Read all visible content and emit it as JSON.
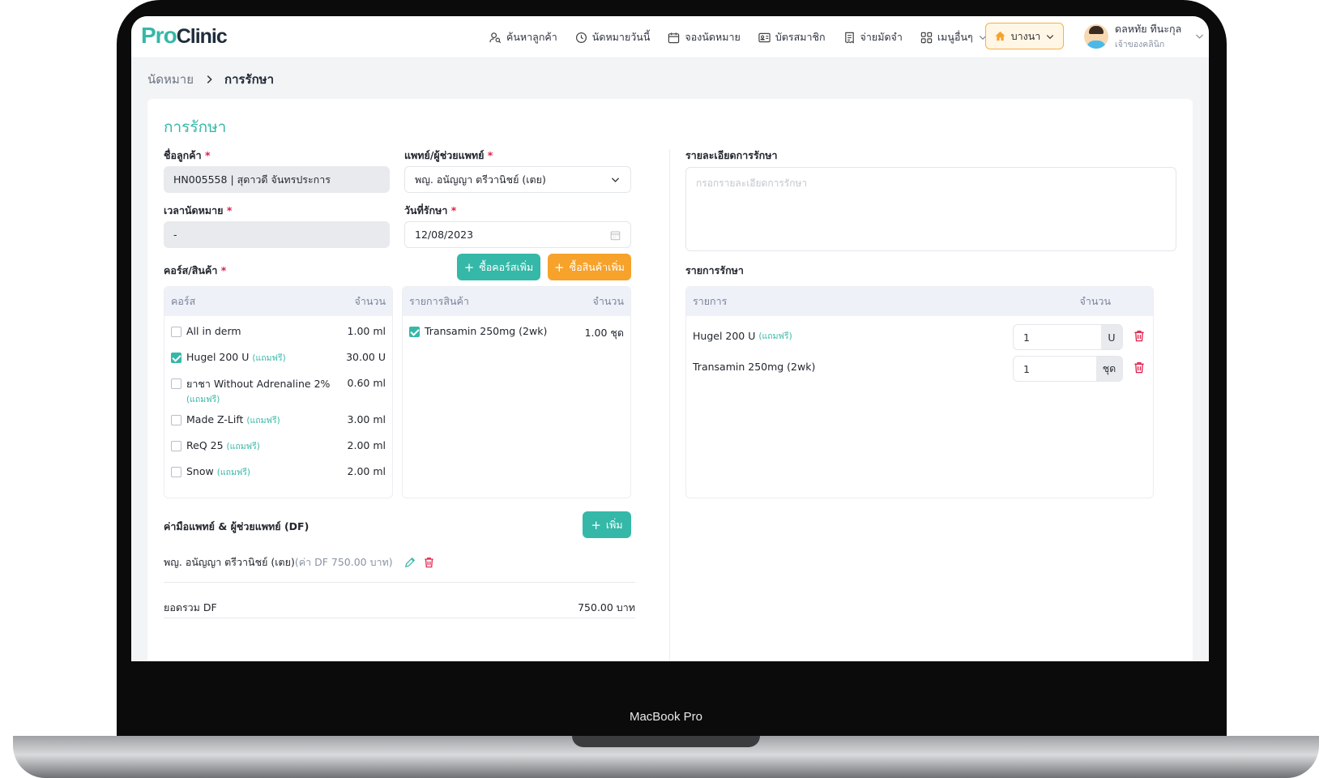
{
  "device_label": "MacBook Pro",
  "brand": {
    "part1": "Pro",
    "part2": "Clinic"
  },
  "nav": {
    "items": [
      {
        "label": "ค้นหาลูกค้า",
        "icon": "user-search-icon"
      },
      {
        "label": "นัดหมายวันนี้",
        "icon": "clock-icon"
      },
      {
        "label": "จองนัดหมาย",
        "icon": "calendar-icon"
      },
      {
        "label": "บัตรสมาชิก",
        "icon": "id-card-icon"
      },
      {
        "label": "จ่ายมัดจำ",
        "icon": "receipt-icon"
      },
      {
        "label": "เมนูอื่นๆ",
        "icon": "grid-icon"
      }
    ],
    "branch": "บางนา",
    "user_name": "ดลหทัย ทีนะกุล",
    "user_role": "เจ้าของคลินิก"
  },
  "breadcrumb": {
    "parent": "นัดหมาย",
    "current": "การรักษา"
  },
  "form": {
    "title": "การรักษา",
    "customer_label": "ชื่อลูกค้า",
    "customer_value": "HN005558 | สุดาวดี จันทรประการ",
    "doctor_label": "แพทย์/ผู้ช่วยแพทย์",
    "doctor_value": "พญ. อนัญญา ตรีวานิชย์ (เตย)",
    "appt_time_label": "เวลานัดหมาย",
    "appt_time_value": "-",
    "treat_date_label": "วันที่รักษา",
    "treat_date_value": "12/08/2023",
    "details_label": "รายละเอียดการรักษา",
    "details_placeholder": "กรอกรายละเอียดการรักษา",
    "course_product_label": "คอร์ส/สินค้า",
    "buy_course_btn": "ซื้อคอร์สเพิ่ม",
    "buy_product_btn": "ซื้อสินค้าเพิ่ม",
    "treat_list_label": "รายการรักษา"
  },
  "courses": {
    "col_name": "คอร์ส",
    "col_qty": "จำนวน",
    "free_tag": "(แถมฟรี)",
    "rows": [
      {
        "name": "All in derm",
        "free": false,
        "qty": "1.00 ml",
        "checked": false
      },
      {
        "name": "Hugel 200 U",
        "free": true,
        "qty": "30.00 U",
        "checked": true
      },
      {
        "name": "ยาชา Without Adrenaline 2%",
        "free": true,
        "qty": "0.60 ml",
        "checked": false
      },
      {
        "name": "Made Z-Lift",
        "free": true,
        "qty": "3.00 ml",
        "checked": false
      },
      {
        "name": "ReQ 25",
        "free": true,
        "qty": "2.00 ml",
        "checked": false
      },
      {
        "name": "Snow",
        "free": true,
        "qty": "2.00 ml",
        "checked": false
      }
    ]
  },
  "products": {
    "col_name": "รายการสินค้า",
    "col_qty": "จำนวน",
    "rows": [
      {
        "name": "Transamin 250mg (2wk)",
        "qty": "1.00 ชุด",
        "checked": true
      }
    ]
  },
  "treatments": {
    "col_name": "รายการ",
    "col_qty": "จำนวน",
    "rows": [
      {
        "name": "Hugel 200 U",
        "free_tag": "(แถมฟรี)",
        "qty": "1",
        "unit": "U"
      },
      {
        "name": "Transamin 250mg (2wk)",
        "free_tag": "",
        "qty": "1",
        "unit": "ชุด"
      }
    ]
  },
  "df": {
    "label": "ค่ามือแพทย์ & ผู้ช่วยแพทย์ (DF)",
    "add_btn": "เพิ่ม",
    "entry_name": "พญ. อนัญญา ตรีวานิชย์ (เตย)",
    "entry_note": "(ค่า DF 750.00 บาท)",
    "total_label": "ยอดรวม DF",
    "total_value": "750.00 บาท"
  },
  "colors": {
    "accent": "#35b8a8",
    "orange": "#f6a22b",
    "danger": "#e11d48"
  }
}
